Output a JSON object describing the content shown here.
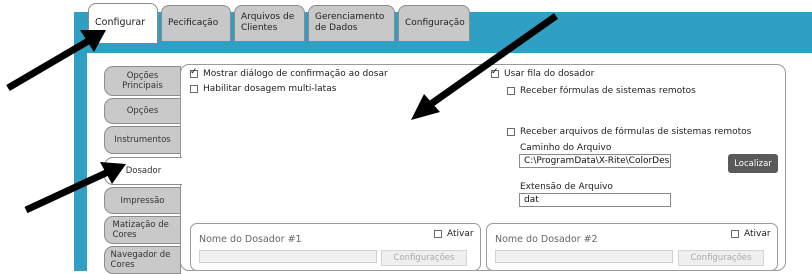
{
  "tabs": [
    {
      "label": "Configurar",
      "active": true
    },
    {
      "label": "Pecificação",
      "active": false
    },
    {
      "label": "Arquivos de Clientes",
      "active": false
    },
    {
      "label": "Gerenciamento de Dados",
      "active": false
    },
    {
      "label": "Configuração",
      "active": false
    }
  ],
  "sidebar": {
    "items": [
      {
        "label": "Opções Principais",
        "active": false
      },
      {
        "label": "Opções",
        "active": false
      },
      {
        "label": "Instrumentos",
        "active": false
      },
      {
        "label": "Dosador",
        "active": true
      },
      {
        "label": "Impressão",
        "active": false
      },
      {
        "label": "Matização de Cores",
        "active": false
      },
      {
        "label": "Navegador de Cores",
        "active": false
      }
    ]
  },
  "options": {
    "show_confirm_dialog": {
      "label": "Mostrar diálogo de confirmação ao dosar",
      "checked": true
    },
    "multi_can": {
      "label": "Habilitar dosagem multi-latas",
      "checked": false
    },
    "use_queue": {
      "label": "Usar fila do dosador",
      "checked": true
    },
    "receive_formulas": {
      "label": "Receber fórmulas de sistemas remotos",
      "checked": false
    },
    "receive_files": {
      "label": "Receber arquivos de fórmulas de sistemas remotos",
      "checked": false
    }
  },
  "file_path": {
    "label": "Caminho do Arquivo",
    "value": "C:\\ProgramData\\X-Rite\\ColorDesig"
  },
  "browse_button": "Localizar",
  "file_ext": {
    "label": "Extensão de Arquivo",
    "value": "dat"
  },
  "dosers": [
    {
      "name": "Nome do Dosador #1",
      "activate_label": "Ativar",
      "config_label": "Configurações"
    },
    {
      "name": "Nome do Dosador #2",
      "activate_label": "Ativar",
      "config_label": "Configurações"
    }
  ]
}
